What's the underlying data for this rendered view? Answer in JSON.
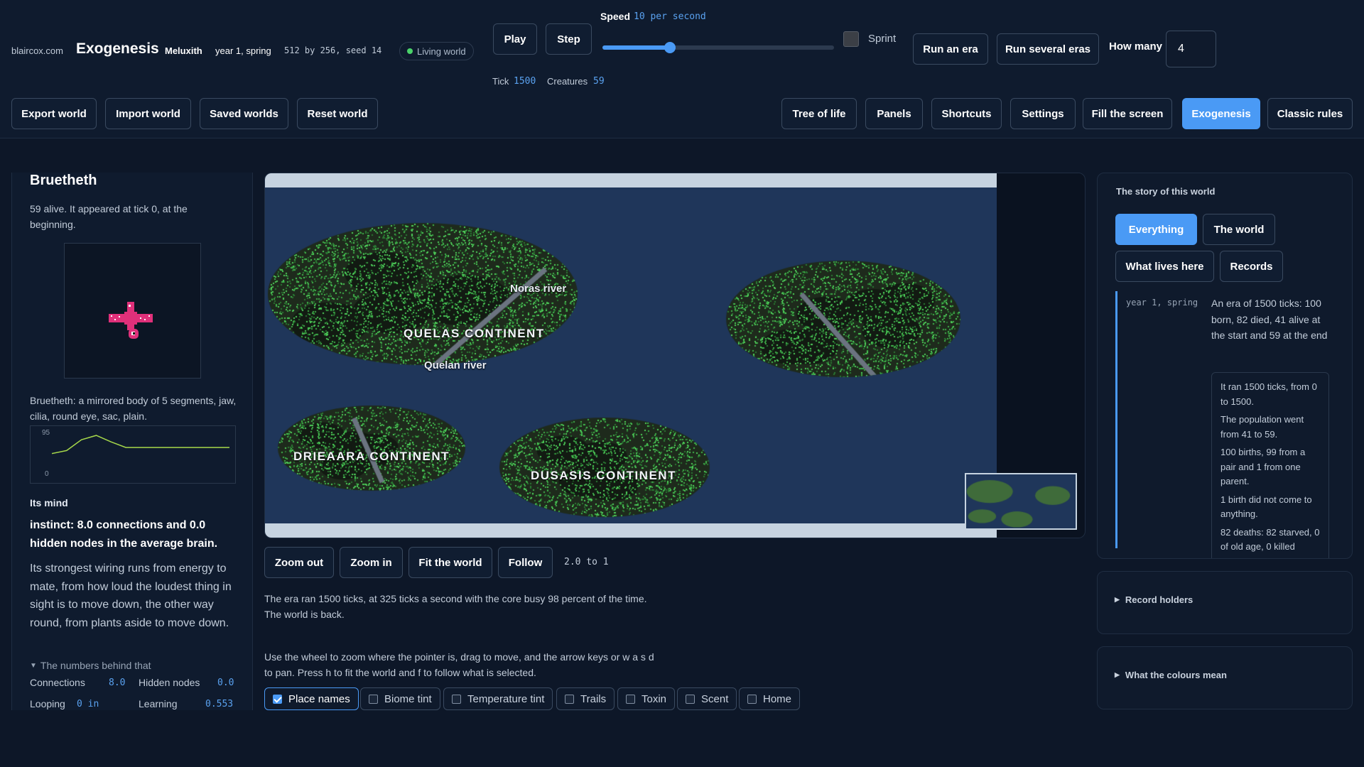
{
  "header": {
    "site": "blaircox.com",
    "app_title": "Exogenesis",
    "world_name": "Meluxith",
    "date": "year 1, spring",
    "size_seed": "512 by 256, seed 14",
    "status": "Living world",
    "play": "Play",
    "step": "Step",
    "speed_label": "Speed",
    "speed_value": "10 per second",
    "speed_fraction": 0.29,
    "sprint": "Sprint",
    "run_era": "Run an era",
    "run_several": "Run several eras",
    "how_many_label": "How many",
    "how_many_value": "4",
    "tick_label": "Tick",
    "tick_value": "1500",
    "creatures_label": "Creatures",
    "creatures_value": "59"
  },
  "toolbar": {
    "export": "Export world",
    "import": "Import world",
    "saved": "Saved worlds",
    "reset": "Reset world",
    "tree": "Tree of life",
    "panels": "Panels",
    "shortcuts": "Shortcuts",
    "settings": "Settings",
    "fill": "Fill the screen",
    "exogenesis": "Exogenesis",
    "classic": "Classic rules"
  },
  "species": {
    "name": "Bruetheth",
    "summary": "59 alive. It appeared at tick 0, at the beginning.",
    "description": "Bruetheth: a mirrored body of 5 segments, jaw, cilia, round eye, sac, plain.",
    "graph_max": "95",
    "graph_min": "0",
    "graph_values": [
      48,
      55,
      80,
      90,
      75,
      62,
      62,
      62,
      62,
      62,
      62,
      62,
      62
    ],
    "mind_heading": "Its mind",
    "mind_instinct": "instinct: 8.0 connections and 0.0 hidden nodes in the average brain.",
    "mind_wiring": "Its strongest wiring runs from energy to mate, from how loud the loudest thing in sight is to move down, the other way round, from plants aside to move down.",
    "numbers_toggle": "The numbers behind that",
    "connections_label": "Connections",
    "connections_value": "8.0",
    "hidden_label": "Hidden nodes",
    "hidden_value": "0.0",
    "looping_label": "Looping",
    "looping_value": "0 in",
    "learning_label": "Learning",
    "learning_value": "0.553"
  },
  "map": {
    "continents": [
      "QUELAS CONTINENT",
      "DRIEAARA CONTINENT",
      "DUSASIS CONTINENT"
    ],
    "rivers": [
      "Noras river",
      "Quelan river"
    ],
    "zoom_out": "Zoom out",
    "zoom_in": "Zoom in",
    "fit": "Fit the world",
    "follow": "Follow",
    "zoom_level": "2.0 to 1",
    "era_info_1": "The era ran 1500 ticks, at 325 ticks a second with the core busy 98 percent of the time.",
    "era_info_2": "The world is back.",
    "help_1": "Use the wheel to zoom where the pointer is, drag to move, and the arrow keys or w a s d",
    "help_2": "to pan. Press h to fit the world and f to follow what is selected.",
    "overlays": [
      {
        "label": "Place names",
        "checked": true
      },
      {
        "label": "Biome tint",
        "checked": false
      },
      {
        "label": "Temperature tint",
        "checked": false
      },
      {
        "label": "Trails",
        "checked": false
      },
      {
        "label": "Toxin",
        "checked": false
      },
      {
        "label": "Scent",
        "checked": false
      },
      {
        "label": "Home",
        "checked": false
      }
    ]
  },
  "story": {
    "title": "The story of this world",
    "tabs": [
      "Everything",
      "The world",
      "What lives here",
      "Records"
    ],
    "entry_date": "year 1, spring",
    "entry_text": "An era of 1500 ticks: 100 born, 82 died, 41 alive at the start and 59 at the end",
    "details": [
      "It ran 1500 ticks, from 0 to 1500.",
      "The population went from 41 to 59.",
      "100 births, 99 from a pair and 1 from one parent.",
      "1 birth did not come to anything.",
      "82 deaths: 82 starved, 0 of old age, 0 killed"
    ],
    "record_holders": "Record holders",
    "colours": "What the colours mean"
  },
  "colors": {
    "accent": "#4a9af5",
    "ocean": "#1f365a",
    "land": "#1e2a1c",
    "plant": "#3fb24a",
    "creature": "#e0307a",
    "graph_line": "#a6d84a"
  }
}
